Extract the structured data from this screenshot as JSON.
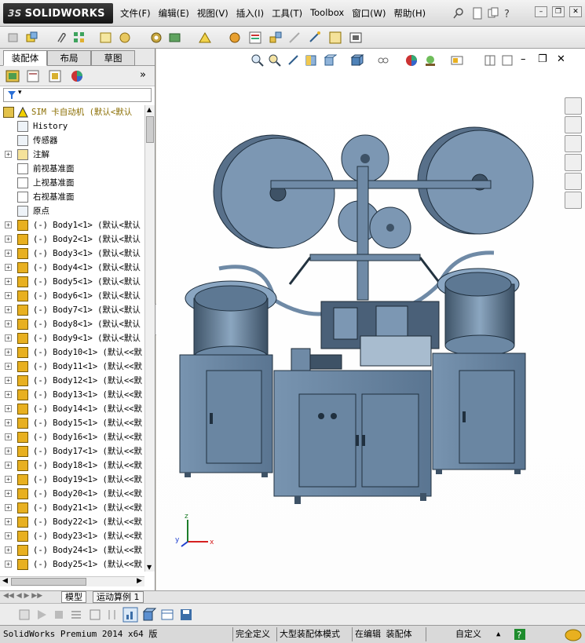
{
  "app": {
    "brand": "SOLIDWORKS",
    "brand_prefix": "3S"
  },
  "menu": [
    "文件(F)",
    "编辑(E)",
    "视图(V)",
    "插入(I)",
    "工具(T)",
    "Toolbox",
    "窗口(W)",
    "帮助(H)"
  ],
  "panel_tabs": [
    "装配体",
    "布局",
    "草图"
  ],
  "tree": {
    "root": "SIM 卡自动机  (默认<默认",
    "fixed": [
      {
        "label": "History",
        "icon": "history-icon"
      },
      {
        "label": "传感器",
        "icon": "sensor-icon"
      },
      {
        "label": "注解",
        "icon": "annotation-icon"
      },
      {
        "label": "前视基准面",
        "icon": "plane-icon"
      },
      {
        "label": "上视基准面",
        "icon": "plane-icon"
      },
      {
        "label": "右视基准面",
        "icon": "plane-icon"
      },
      {
        "label": "原点",
        "icon": "origin-icon"
      }
    ],
    "bodies": [
      "(-) Body1<1> (默认<默认",
      "(-) Body2<1> (默认<默认",
      "(-) Body3<1> (默认<默认",
      "(-) Body4<1> (默认<默认",
      "(-) Body5<1> (默认<默认",
      "(-) Body6<1> (默认<默认",
      "(-) Body7<1> (默认<默认",
      "(-) Body8<1> (默认<默认",
      "(-) Body9<1> (默认<默认",
      "(-) Body10<1> (默认<<默",
      "(-) Body11<1> (默认<<默",
      "(-) Body12<1> (默认<<默",
      "(-) Body13<1> (默认<<默",
      "(-) Body14<1> (默认<<默",
      "(-) Body15<1> (默认<<默",
      "(-) Body16<1> (默认<<默",
      "(-) Body17<1> (默认<<默",
      "(-) Body18<1> (默认<<默",
      "(-) Body19<1> (默认<<默",
      "(-) Body20<1> (默认<<默",
      "(-) Body21<1> (默认<<默",
      "(-) Body22<1> (默认<<默",
      "(-) Body23<1> (默认<<默",
      "(-) Body24<1> (默认<<默",
      "(-) Body25<1> (默认<<默"
    ]
  },
  "bottom_tabs": [
    "模型",
    "运动算例 1"
  ],
  "axes": {
    "x": "x",
    "y": "y",
    "z": "z"
  },
  "status": {
    "product": "SolidWorks Premium 2014 x64 版",
    "state": "完全定义",
    "mode": "大型装配体模式",
    "editing": "在编辑 装配体",
    "custom": "自定义"
  },
  "colors": {
    "machine": "#6f8aa6",
    "machine_dark": "#3e5266",
    "accent_yellow": "#e8b020"
  }
}
